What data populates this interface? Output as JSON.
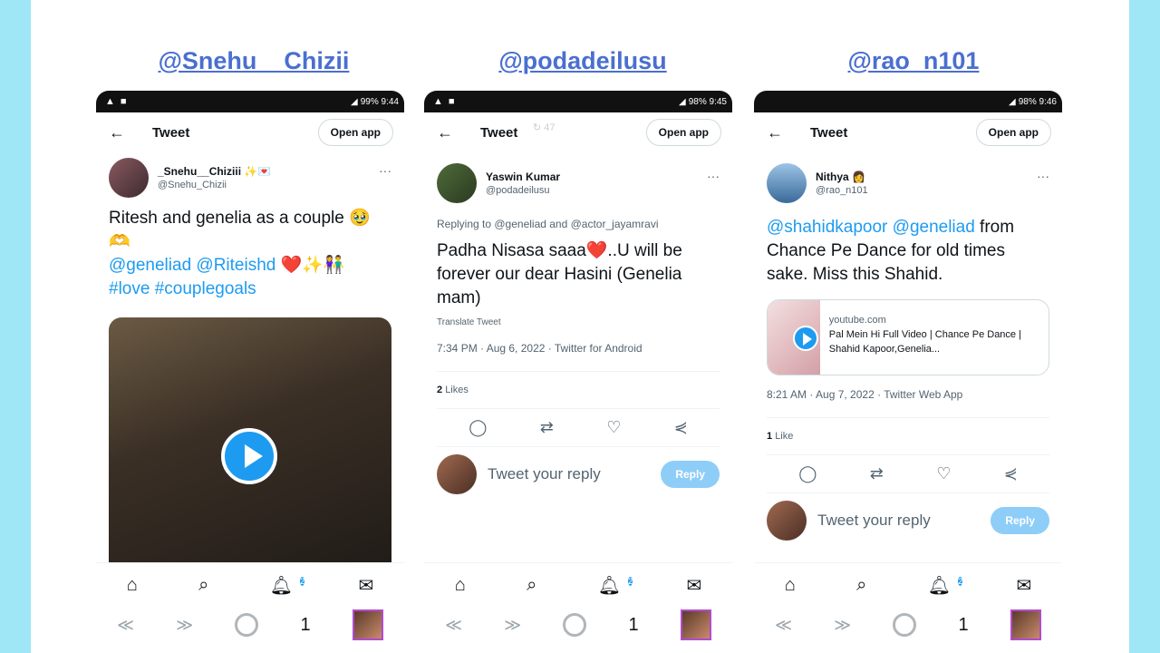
{
  "handles": [
    "@Snehu__Chizii",
    "@podadeilusu",
    "@rao_n101"
  ],
  "common": {
    "tweet_title": "Tweet",
    "open_app": "Open app",
    "back": "←",
    "more": "···",
    "reply_placeholder": "Tweet your reply",
    "reply_btn": "Reply",
    "notif_badge": "2",
    "tab_count": "1"
  },
  "phone1": {
    "status_right": "99% 9:44",
    "user_name": "_Snehu__Chiziii ✨💌",
    "user_handle": "@Snehu_Chizii",
    "text": "Ritesh and genelia as a couple 🥹🫶",
    "mentions": "@geneliad @Riteishd ❤️✨👫",
    "tags": "#love #couplegoals"
  },
  "phone2": {
    "status_right": "98% 9:45",
    "ghost": "↻ 47",
    "user_name": "Yaswin Kumar",
    "user_handle": "@podadeilusu",
    "replying": "Replying to @geneliad and @actor_jayamravi",
    "text": "Padha Nisasa saaa❤️..U will be forever our dear Hasini (Genelia mam)",
    "translate": "Translate Tweet",
    "meta": "7:34 PM · Aug 6, 2022 · Twitter for Android",
    "likes_num": "2",
    "likes_label": "Likes"
  },
  "phone3": {
    "status_right": "98% 9:46",
    "user_name": "Nithya 👩",
    "user_handle": "@rao_n101",
    "mentions": "@shahidkapoor @geneliad",
    "text": " from Chance Pe Dance for old times sake.  Miss this Shahid.",
    "card_domain": "youtube.com",
    "card_title": "Pal Mein Hi Full Video | Chance Pe Dance | Shahid Kapoor,Genelia...",
    "meta": "8:21 AM · Aug 7, 2022 · Twitter Web App",
    "likes_num": "1",
    "likes_label": "Like"
  }
}
